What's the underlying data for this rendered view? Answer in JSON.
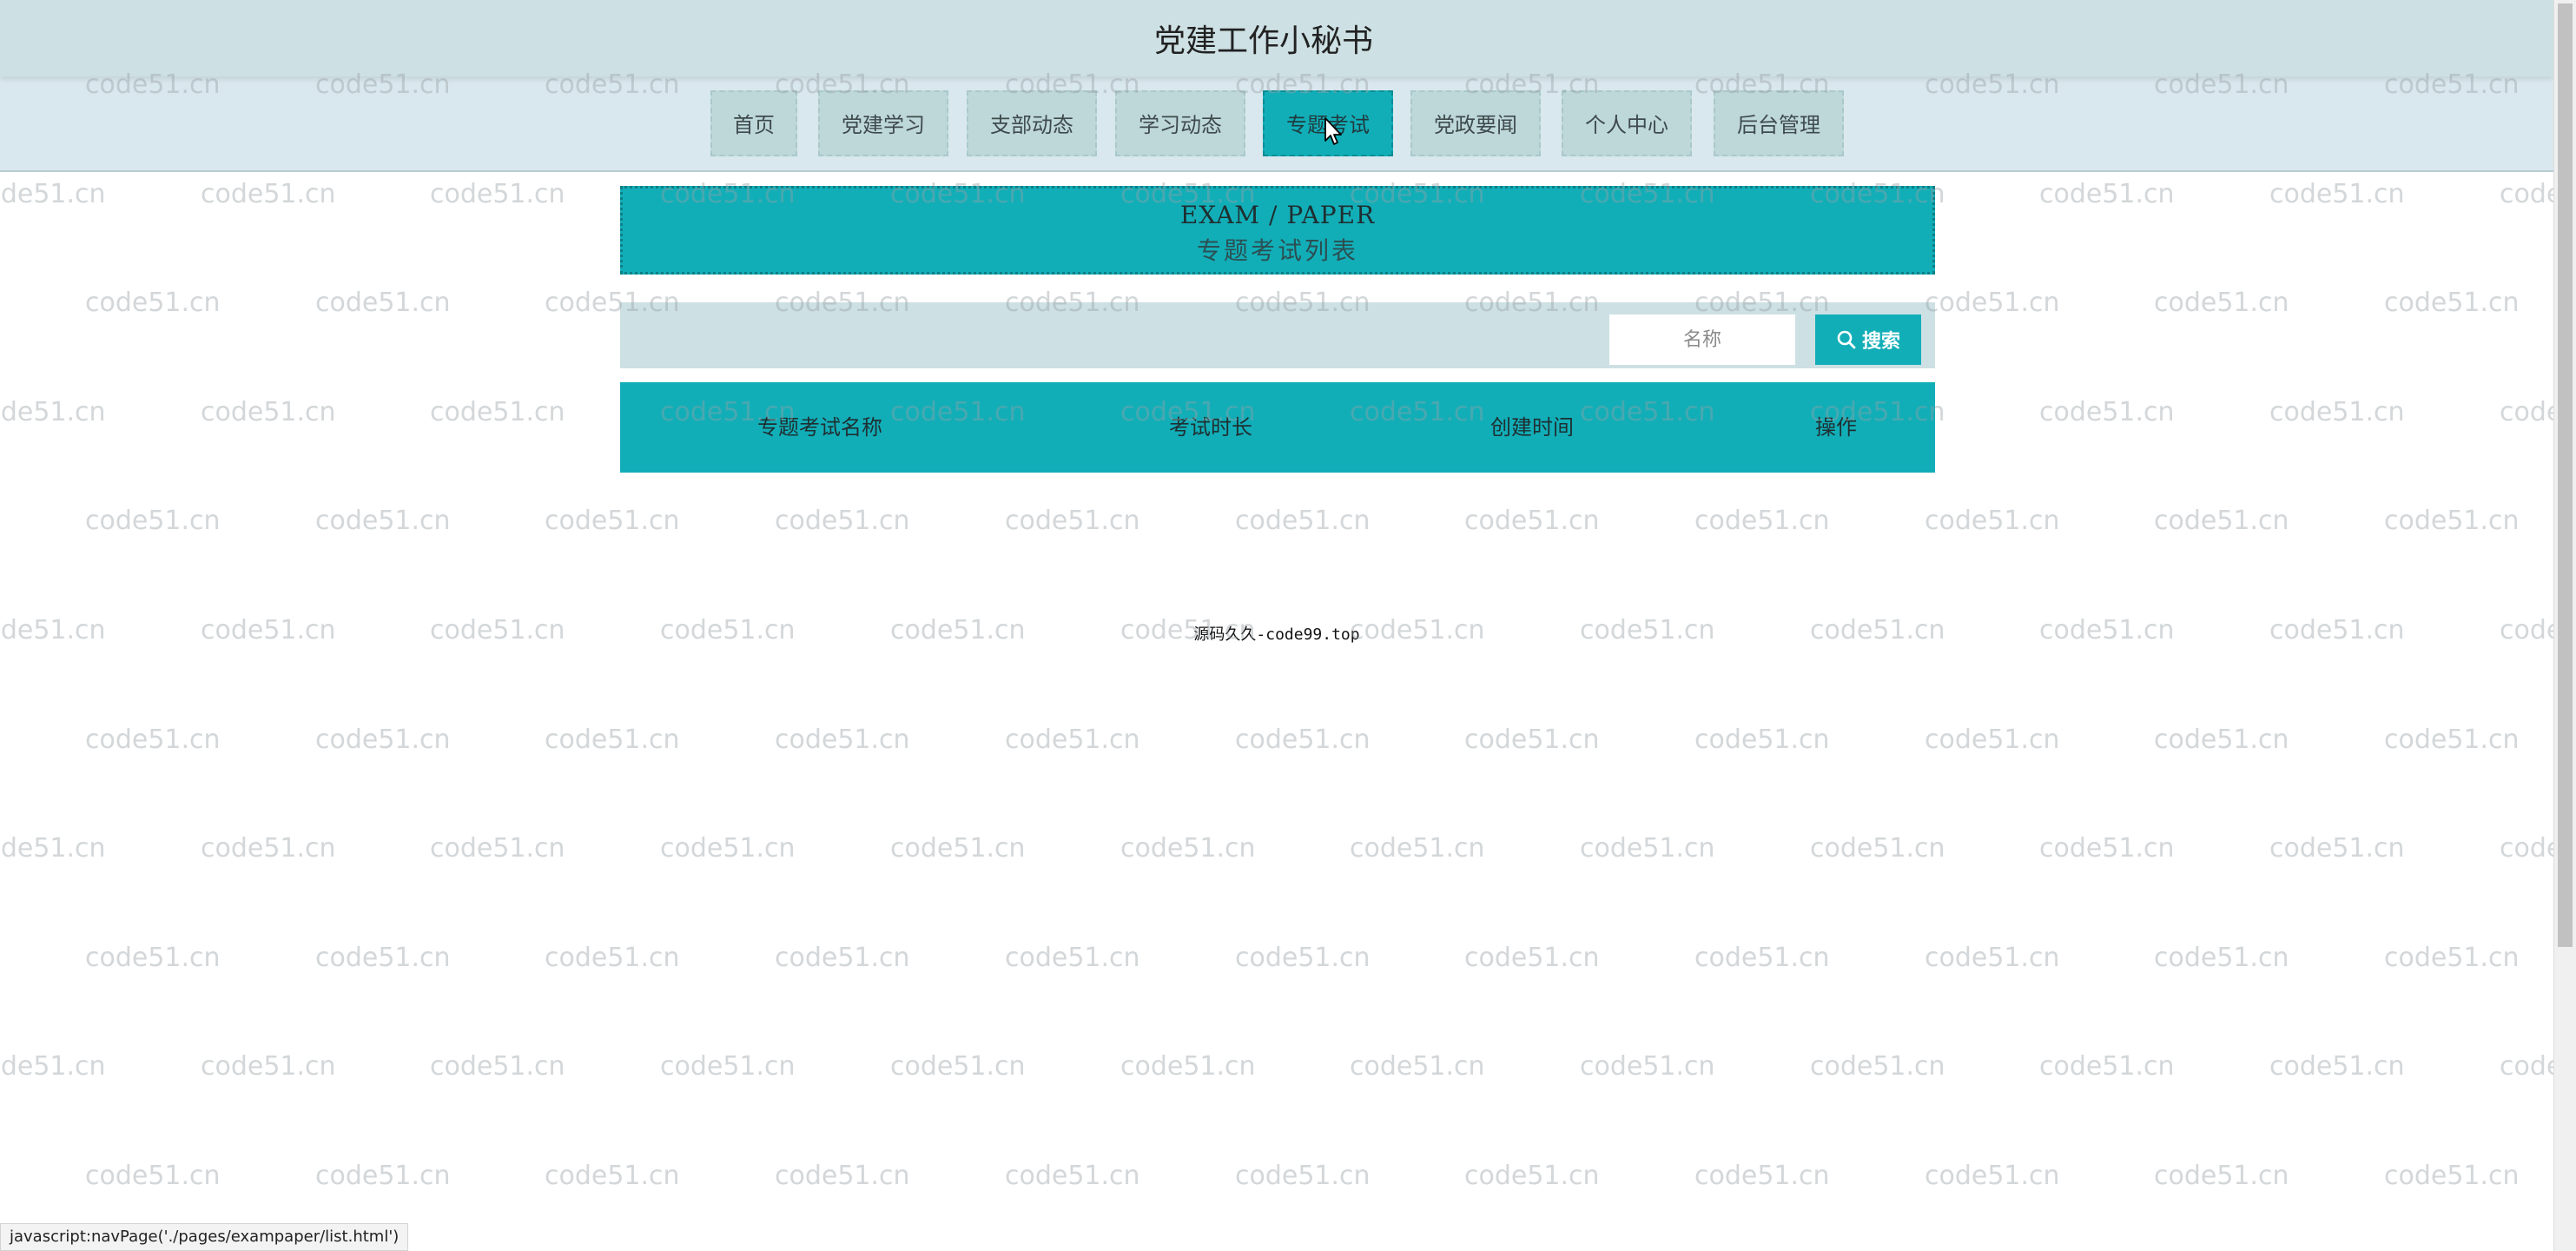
{
  "header": {
    "title": "党建工作小秘书"
  },
  "nav": {
    "items": [
      {
        "label": "首页",
        "active": false
      },
      {
        "label": "党建学习",
        "active": false
      },
      {
        "label": "支部动态",
        "active": false
      },
      {
        "label": "学习动态",
        "active": false
      },
      {
        "label": "专题考试",
        "active": true
      },
      {
        "label": "党政要闻",
        "active": false
      },
      {
        "label": "个人中心",
        "active": false
      },
      {
        "label": "后台管理",
        "active": false
      }
    ]
  },
  "banner": {
    "en": "EXAM / PAPER",
    "cn": "专题考试列表"
  },
  "search": {
    "placeholder": "名称",
    "button_label": "搜索",
    "icon": "search-icon"
  },
  "table": {
    "columns": [
      "专题考试名称",
      "考试时长",
      "创建时间",
      "操作"
    ],
    "rows": []
  },
  "footer": {
    "text": "源码久久-code99.top"
  },
  "watermark": {
    "text": "code51.cn"
  },
  "status_bar": {
    "text": "javascript:navPage('./pages/exampaper/list.html')"
  },
  "colors": {
    "accent": "#12aeb8",
    "header_bg": "#cde0e3",
    "nav_bg": "#d9e8ee",
    "nav_item_bg": "#bed8d9"
  }
}
